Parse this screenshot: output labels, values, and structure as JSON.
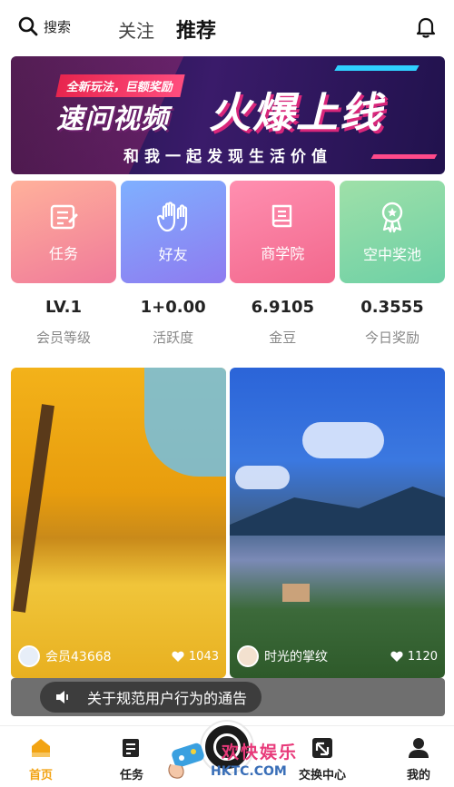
{
  "header": {
    "search_label": "搜索",
    "tab_follow": "关注",
    "tab_recommend": "推荐"
  },
  "banner": {
    "tag": "全新玩法，巨额奖励",
    "sub_title": "速问视频",
    "title": "火爆上线",
    "slogan": "和我一起发现生活价值"
  },
  "features": [
    {
      "label": "任务",
      "icon": "task-list-icon"
    },
    {
      "label": "好友",
      "icon": "hand-icon"
    },
    {
      "label": "商学院",
      "icon": "book-icon"
    },
    {
      "label": "空中奖池",
      "icon": "medal-icon"
    }
  ],
  "stats": [
    {
      "value": "LV.1",
      "label": "会员等级"
    },
    {
      "value": "1+0.00",
      "label": "活跃度"
    },
    {
      "value": "6.9105",
      "label": "金豆"
    },
    {
      "value": "0.3555",
      "label": "今日奖励"
    }
  ],
  "videos": [
    {
      "author": "会员43668",
      "likes": "1043"
    },
    {
      "author": "时光的掌纹",
      "likes": "1120"
    }
  ],
  "notice": {
    "text": "关于规范用户行为的通告"
  },
  "nav": {
    "home": "首页",
    "task": "任务",
    "exchange": "交换中心",
    "mine": "我的"
  },
  "watermark": {
    "line1": "欢快娱乐",
    "line2": "HKTC.COM"
  },
  "colors": {
    "accent": "#f2a312",
    "banner_bg": "#21124d",
    "notice_bg": "#6f6f6f"
  }
}
